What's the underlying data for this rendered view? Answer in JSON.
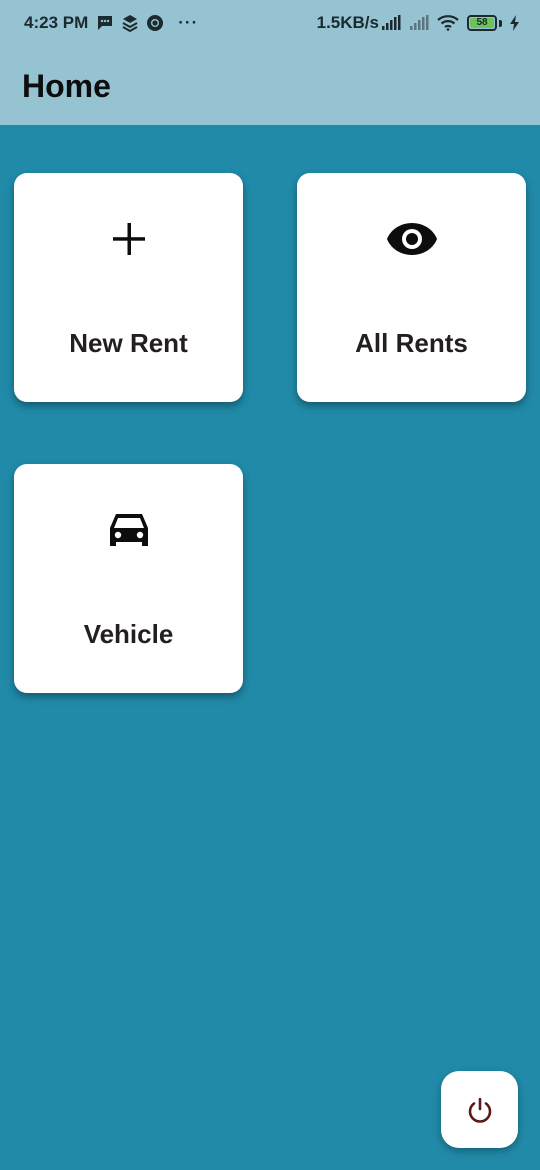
{
  "status_bar": {
    "time": "4:23 PM",
    "more": "···",
    "network_speed": "1.5KB/s",
    "battery_level": "58",
    "icons": [
      "message-icon",
      "layers-icon",
      "chrome-icon",
      "signal-icon",
      "signal-weak-icon",
      "wifi-icon",
      "battery-icon",
      "charging-icon"
    ]
  },
  "app_bar": {
    "title": "Home",
    "color": "#96c3d2"
  },
  "background_color": "#208aa8",
  "menu": {
    "items": [
      {
        "label": "New Rent",
        "icon": "plus-icon"
      },
      {
        "label": "All Rents",
        "icon": "eye-icon"
      },
      {
        "label": "Vehicle",
        "icon": "car-icon"
      }
    ]
  },
  "fab": {
    "icon": "power-icon",
    "icon_color": "#5a1a1a"
  }
}
